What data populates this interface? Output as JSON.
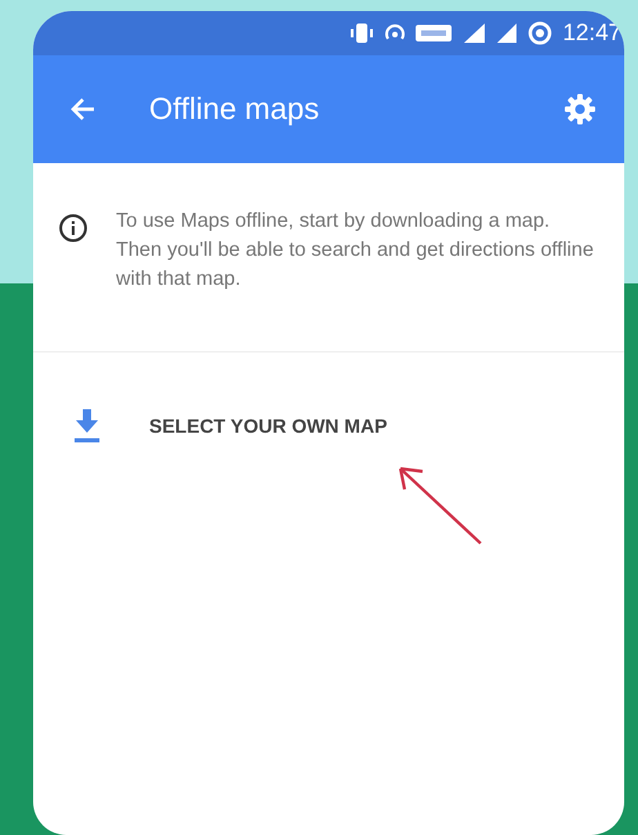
{
  "status_bar": {
    "time": "12:47"
  },
  "app_bar": {
    "title": "Offline maps"
  },
  "info": {
    "text": "To use Maps offline, start by downloading a map. Then you'll be able to search and get directions offline with that map."
  },
  "actions": [
    {
      "label": "SELECT YOUR OWN MAP"
    }
  ]
}
